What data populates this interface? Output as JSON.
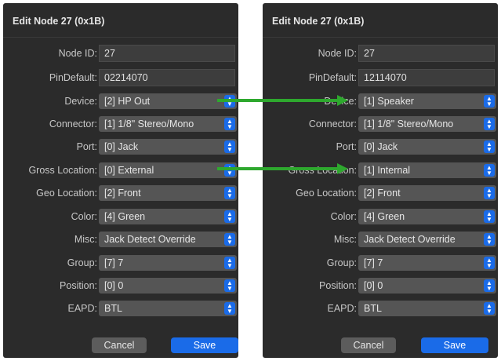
{
  "left_panel": {
    "title": "Edit Node 27 (0x1B)",
    "fields": {
      "node_id": {
        "label": "Node ID:",
        "value": "27"
      },
      "pin_default": {
        "label": "PinDefault:",
        "value": "02214070"
      }
    },
    "popups": [
      {
        "key": "device",
        "label": "Device:",
        "value": "[2] HP Out"
      },
      {
        "key": "connector",
        "label": "Connector:",
        "value": "[1] 1/8\" Stereo/Mono"
      },
      {
        "key": "port",
        "label": "Port:",
        "value": "[0] Jack"
      },
      {
        "key": "gross-location",
        "label": "Gross Location:",
        "value": "[0] External"
      },
      {
        "key": "geo-location",
        "label": "Geo Location:",
        "value": "[2] Front"
      },
      {
        "key": "color",
        "label": "Color:",
        "value": "[4] Green"
      },
      {
        "key": "misc",
        "label": "Misc:",
        "value": "Jack Detect Override"
      },
      {
        "key": "group",
        "label": "Group:",
        "value": "[7] 7"
      },
      {
        "key": "position",
        "label": "Position:",
        "value": "[0] 0"
      },
      {
        "key": "eapd",
        "label": "EAPD:",
        "value": "BTL"
      }
    ],
    "buttons": {
      "cancel": "Cancel",
      "save": "Save"
    }
  },
  "right_panel": {
    "title": "Edit Node 27 (0x1B)",
    "fields": {
      "node_id": {
        "label": "Node ID:",
        "value": "27"
      },
      "pin_default": {
        "label": "PinDefault:",
        "value": "12114070"
      }
    },
    "popups": [
      {
        "key": "device",
        "label": "Device:",
        "value": "[1] Speaker"
      },
      {
        "key": "connector",
        "label": "Connector:",
        "value": "[1] 1/8\" Stereo/Mono"
      },
      {
        "key": "port",
        "label": "Port:",
        "value": "[0] Jack"
      },
      {
        "key": "gross-location",
        "label": "Gross Location:",
        "value": "[1] Internal"
      },
      {
        "key": "geo-location",
        "label": "Geo Location:",
        "value": "[2] Front"
      },
      {
        "key": "color",
        "label": "Color:",
        "value": "[4] Green"
      },
      {
        "key": "misc",
        "label": "Misc:",
        "value": "Jack Detect Override"
      },
      {
        "key": "group",
        "label": "Group:",
        "value": "[7] 7"
      },
      {
        "key": "position",
        "label": "Position:",
        "value": "[0] 0"
      },
      {
        "key": "eapd",
        "label": "EAPD:",
        "value": "BTL"
      }
    ],
    "buttons": {
      "cancel": "Cancel",
      "save": "Save"
    }
  },
  "icons": {
    "stepper": "stepper-chevrons-icon",
    "arrow": "arrow-right-icon"
  },
  "colors": {
    "panel_bg": "#2b2b2b",
    "popup_bg": "#555555",
    "accent": "#1a6be8",
    "arrow": "#2ea82e"
  }
}
